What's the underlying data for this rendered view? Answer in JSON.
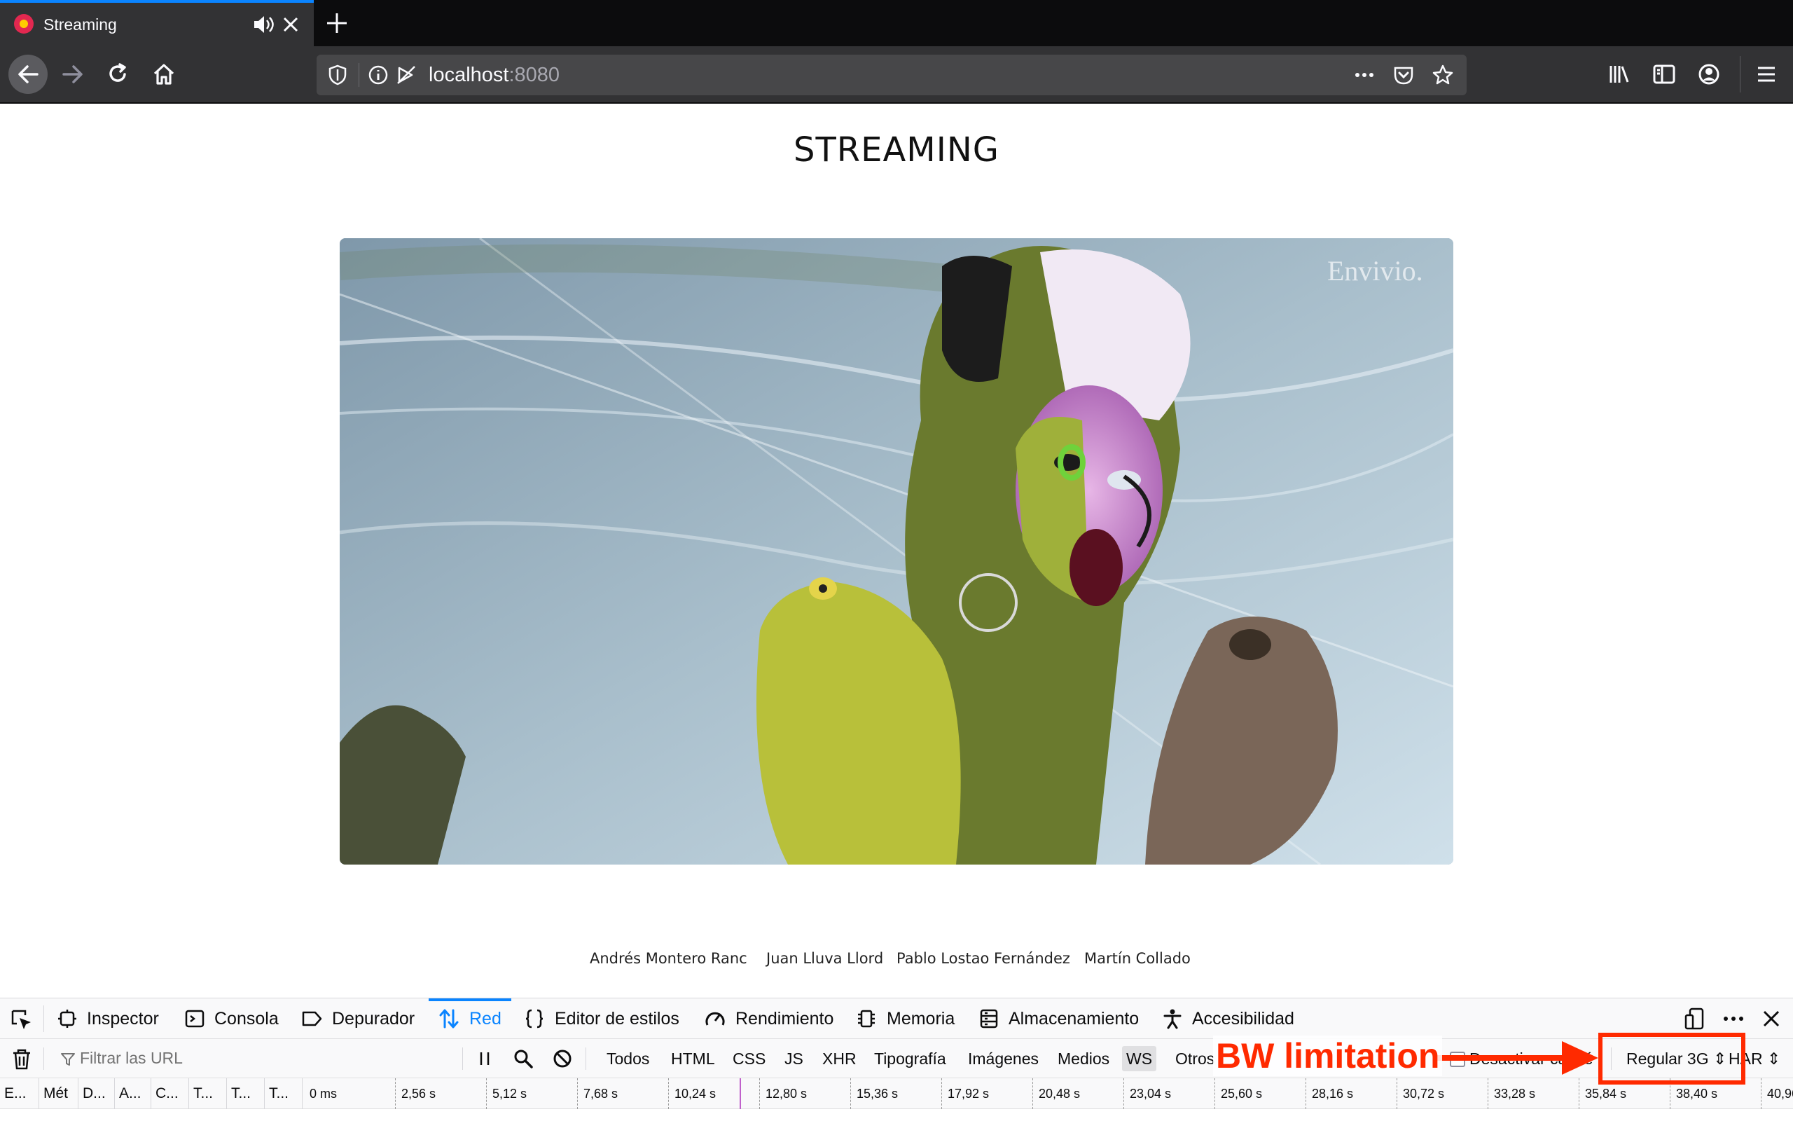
{
  "browser": {
    "tab": {
      "title": "Streaming"
    },
    "url": {
      "host": "localhost",
      "port": ":8080"
    }
  },
  "page": {
    "title": "STREAMING",
    "video": {
      "watermark": "Envivio."
    },
    "credits": [
      "Andrés Montero Ranc",
      "Juan Lluva Llord",
      "Pablo Lostao Fernández",
      "Martín Collado"
    ]
  },
  "devtools": {
    "tabs": [
      {
        "label": "Inspector",
        "icon": "inspector-icon"
      },
      {
        "label": "Consola",
        "icon": "console-icon"
      },
      {
        "label": "Depurador",
        "icon": "debugger-icon"
      },
      {
        "label": "Red",
        "icon": "network-icon",
        "active": true
      },
      {
        "label": "Editor de estilos",
        "icon": "braces-icon"
      },
      {
        "label": "Rendimiento",
        "icon": "performance-icon"
      },
      {
        "label": "Memoria",
        "icon": "memory-icon"
      },
      {
        "label": "Almacenamiento",
        "icon": "storage-icon"
      },
      {
        "label": "Accesibilidad",
        "icon": "accessibility-icon"
      }
    ],
    "filter_placeholder": "Filtrar las URL",
    "type_filters": [
      "Todos",
      "HTML",
      "CSS",
      "JS",
      "XHR",
      "Tipografía",
      "Imágenes",
      "Medios",
      "WS",
      "Otros"
    ],
    "active_filter": "WS",
    "disable_cache": "Desactivar caché",
    "throttling": "Regular 3G",
    "har": "HAR",
    "columns": [
      "E...",
      "Mét",
      "D...",
      "A...",
      "C...",
      "T...",
      "T...",
      "T..."
    ],
    "timeline_ticks": [
      "0 ms",
      "2,56 s",
      "5,12 s",
      "7,68 s",
      "10,24 s",
      "12,80 s",
      "15,36 s",
      "17,92 s",
      "20,48 s",
      "23,04 s",
      "25,60 s",
      "28,16 s",
      "30,72 s",
      "33,28 s",
      "35,84 s",
      "38,40 s",
      "40,96"
    ]
  },
  "annotation": {
    "label": "BW limitation",
    "color": "#ff2a00"
  },
  "colors": {
    "accent": "#0a84ff",
    "chrome_dark": "#0c0c0d",
    "chrome": "#323234",
    "annotation": "#ff2a00"
  }
}
